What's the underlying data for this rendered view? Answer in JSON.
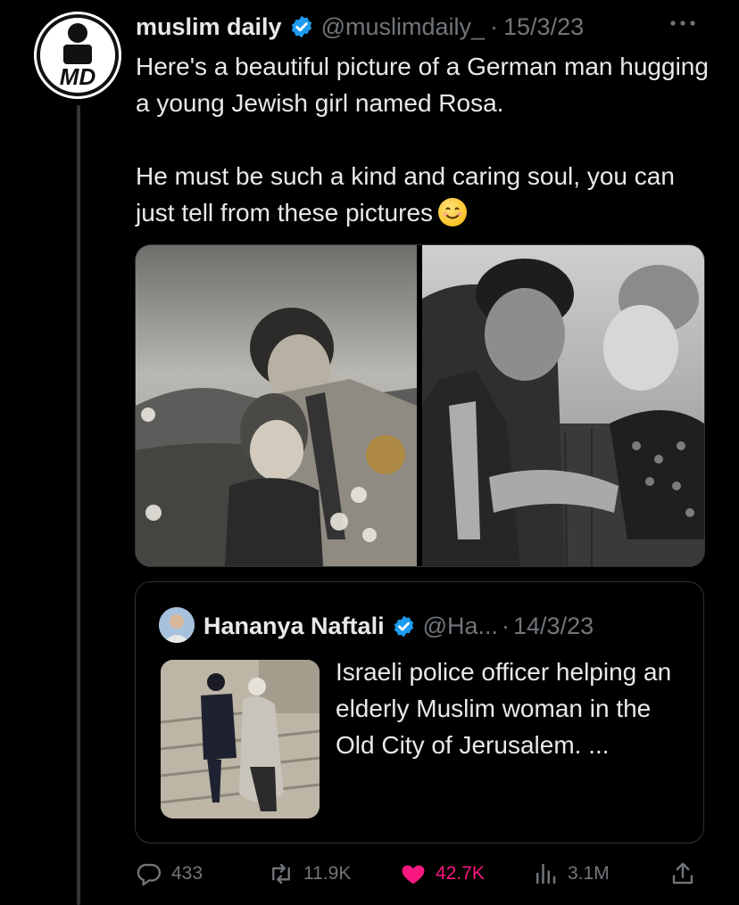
{
  "tweet": {
    "author_name": "muslim daily",
    "handle": "@muslimdaily_",
    "separator": "·",
    "date": "15/3/23",
    "more_icon": "more-horizontal-icon",
    "avatar_label": "MD",
    "text": "Here's a beautiful picture of a German man hugging a young Jewish girl named Rosa.\n\nHe must be such a kind and caring soul, you can just tell from these pictures",
    "emoji": "smiling-face-icon",
    "images": [
      "photo-1",
      "photo-2"
    ]
  },
  "quote": {
    "author_name": "Hananya Naftali",
    "handle": "@Ha...",
    "separator": "·",
    "date": "14/3/23",
    "text": "Israeli police officer helping an elderly Muslim woman in the Old City of Jerusalem. ..."
  },
  "actions": {
    "replies": "433",
    "reposts": "11.9K",
    "likes": "42.7K",
    "views": "3.1M"
  },
  "colors": {
    "background": "#000000",
    "text": "#e7e9ea",
    "secondary": "#71767b",
    "verified": "#1d9bf0",
    "like": "#f91880",
    "border": "#2f3336"
  }
}
